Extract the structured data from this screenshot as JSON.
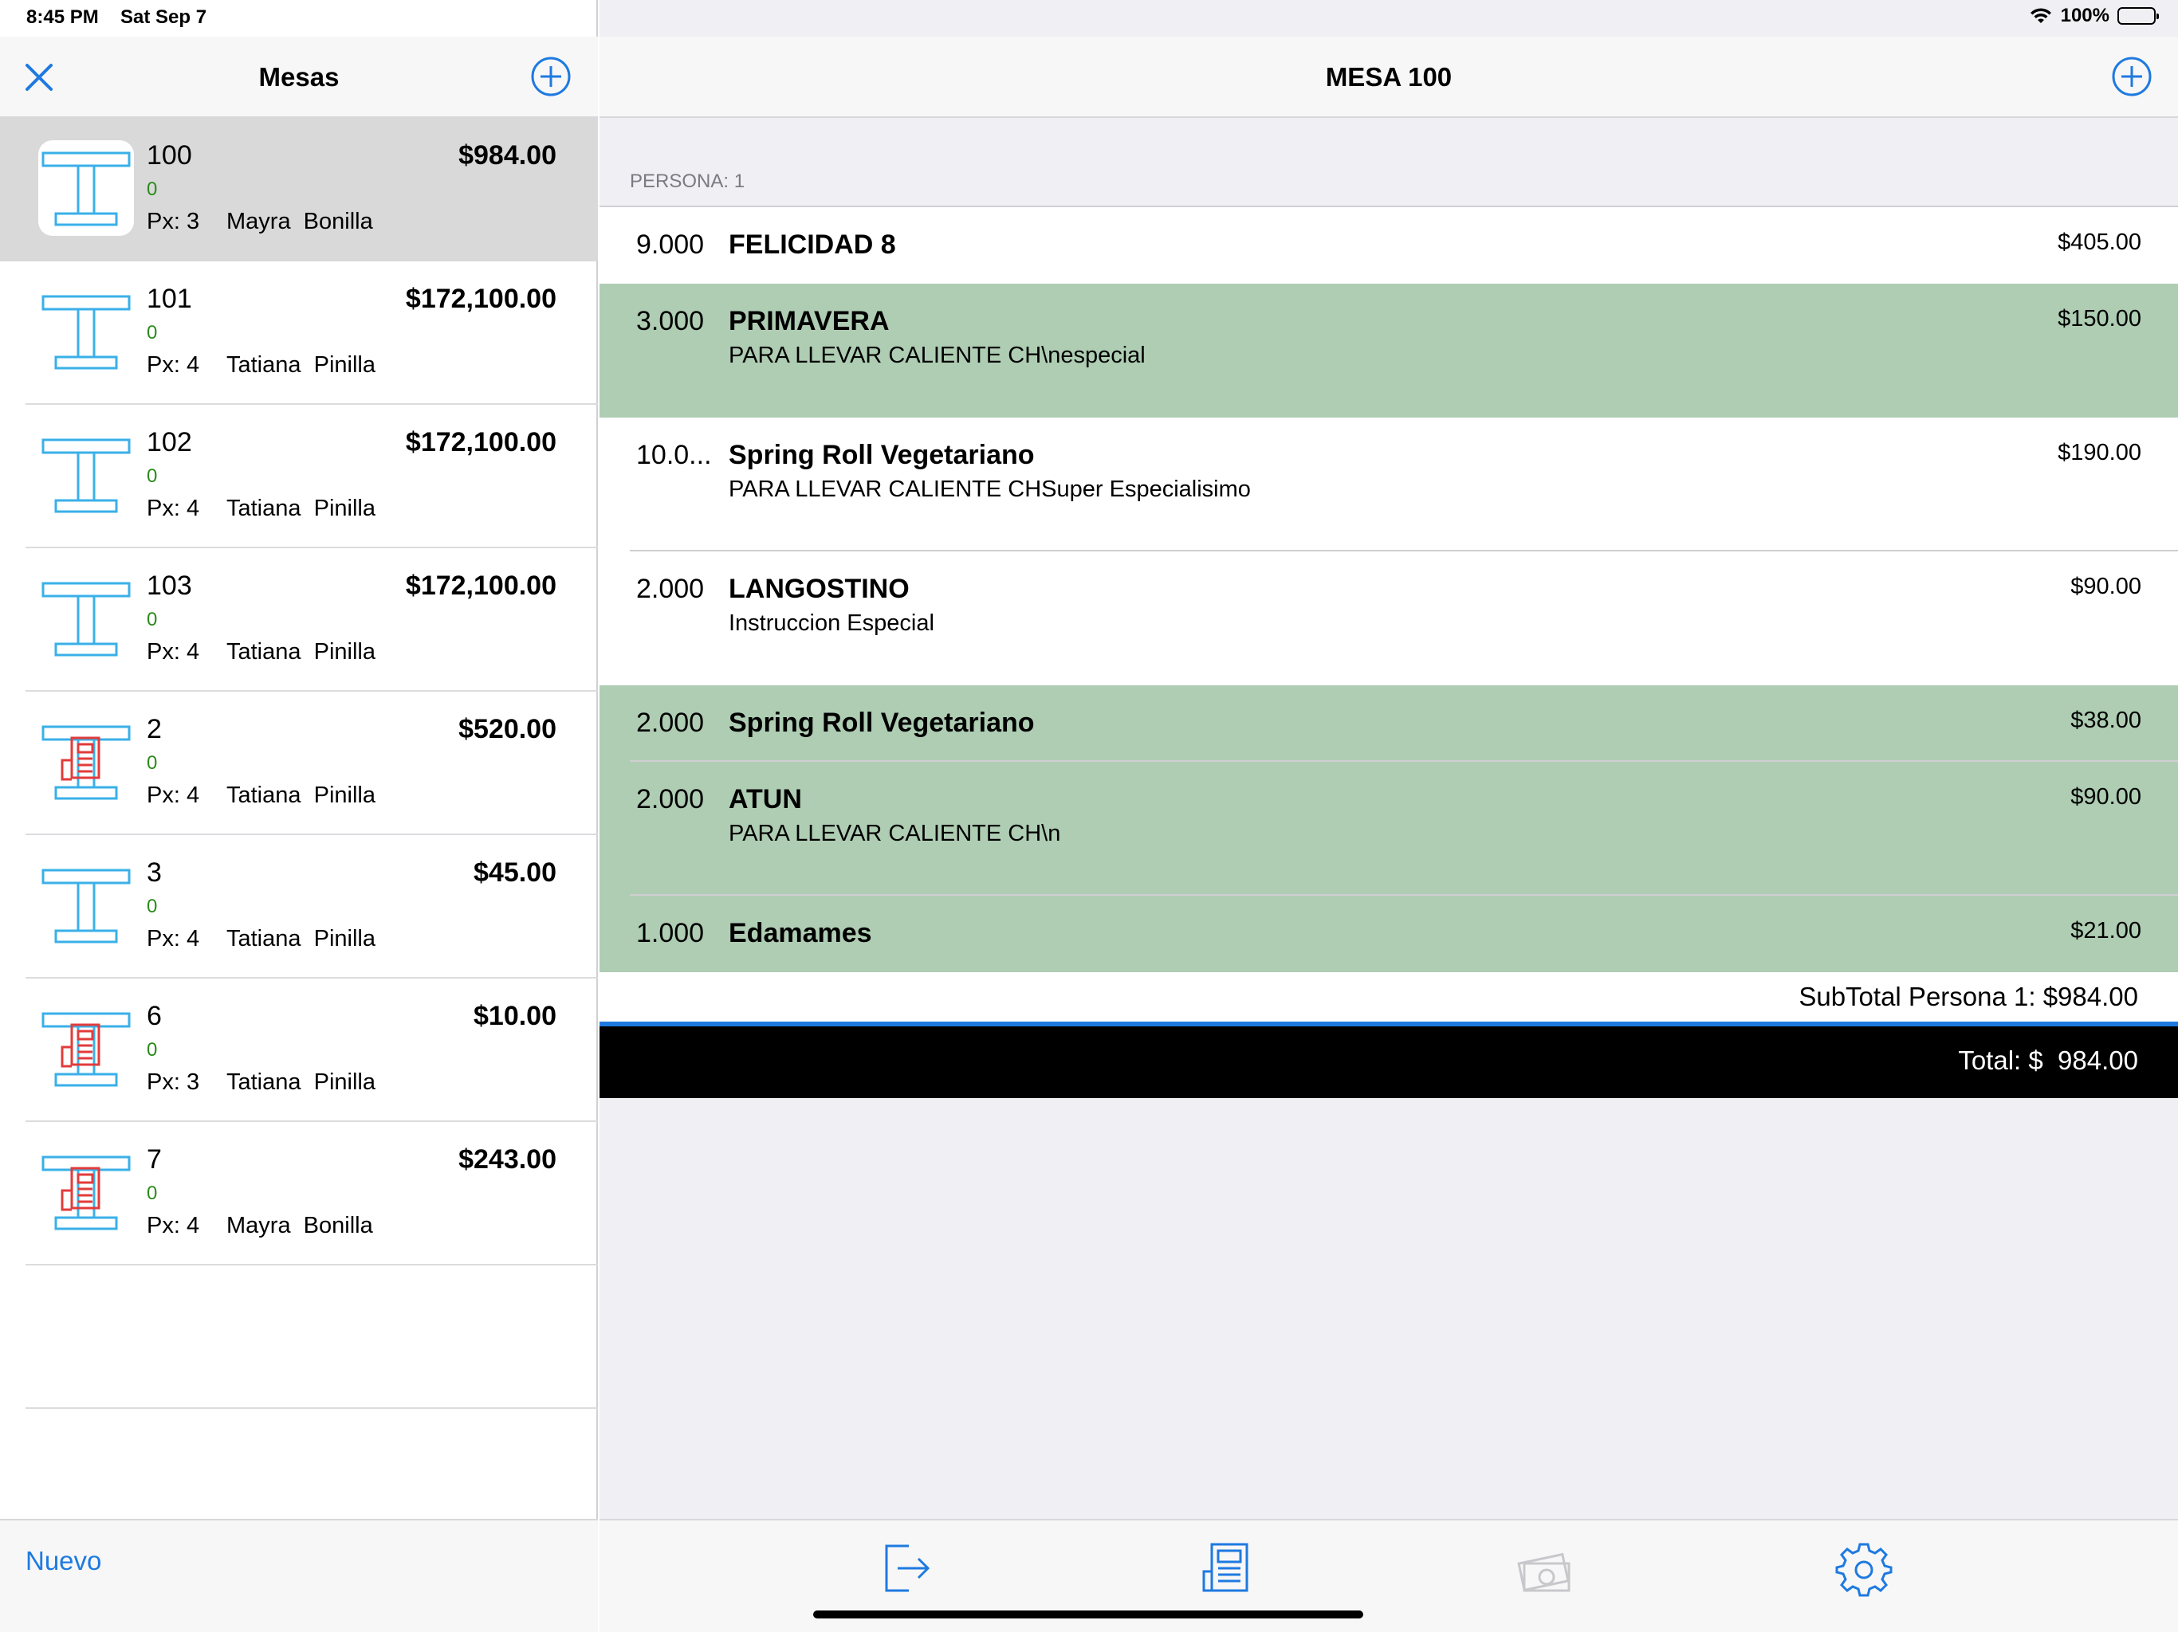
{
  "status_bar": {
    "time": "8:45 PM",
    "date": "Sat Sep 7",
    "battery": "100%"
  },
  "left_panel": {
    "title": "Mesas",
    "tables": [
      {
        "number": "100",
        "zero": "0",
        "px": "Px: 3",
        "waiter": "Mayra  Bonilla",
        "amount": "$984.00",
        "icon": "table-icon",
        "selected": true
      },
      {
        "number": "101",
        "zero": "0",
        "px": "Px: 4",
        "waiter": "Tatiana  Pinilla",
        "amount": "$172,100.00",
        "icon": "table-icon",
        "selected": false
      },
      {
        "number": "102",
        "zero": "0",
        "px": "Px: 4",
        "waiter": "Tatiana  Pinilla",
        "amount": "$172,100.00",
        "icon": "table-icon",
        "selected": false
      },
      {
        "number": "103",
        "zero": "0",
        "px": "Px: 4",
        "waiter": "Tatiana  Pinilla",
        "amount": "$172,100.00",
        "icon": "table-icon",
        "selected": false
      },
      {
        "number": "2",
        "zero": "0",
        "px": "Px: 4",
        "waiter": "Tatiana  Pinilla",
        "amount": "$520.00",
        "icon": "table-with-receipt-icon",
        "selected": false
      },
      {
        "number": "3",
        "zero": "0",
        "px": "Px: 4",
        "waiter": "Tatiana  Pinilla",
        "amount": "$45.00",
        "icon": "table-icon",
        "selected": false
      },
      {
        "number": "6",
        "zero": "0",
        "px": "Px: 3",
        "waiter": "Tatiana  Pinilla",
        "amount": "$10.00",
        "icon": "table-with-receipt-icon",
        "selected": false
      },
      {
        "number": "7",
        "zero": "0",
        "px": "Px: 4",
        "waiter": "Mayra  Bonilla",
        "amount": "$243.00",
        "icon": "table-with-receipt-icon",
        "selected": false
      }
    ],
    "new_button": "Nuevo"
  },
  "right_panel": {
    "title": "MESA 100",
    "persona_header": "PERSONA: 1",
    "items": [
      {
        "qty": "9.000",
        "name": "FELICIDAD 8",
        "note": "",
        "price": "$405.00",
        "highlighted": false,
        "tall": false
      },
      {
        "qty": "3.000",
        "name": "PRIMAVERA",
        "note": "PARA LLEVAR CALIENTE CH\\nespecial",
        "price": "$150.00",
        "highlighted": true,
        "tall": true
      },
      {
        "qty": "10.0...",
        "name": "Spring Roll Vegetariano",
        "note": "PARA LLEVAR CALIENTE CHSuper Especialisimo",
        "price": "$190.00",
        "highlighted": false,
        "tall": true
      },
      {
        "qty": "2.000",
        "name": "LANGOSTINO",
        "note": "Instruccion Especial",
        "price": "$90.00",
        "highlighted": false,
        "tall": true
      },
      {
        "qty": "2.000",
        "name": "Spring Roll Vegetariano",
        "note": "",
        "price": "$38.00",
        "highlighted": true,
        "tall": false
      },
      {
        "qty": "2.000",
        "name": "ATUN",
        "note": "PARA LLEVAR CALIENTE CH\\n",
        "price": "$90.00",
        "highlighted": true,
        "tall": true
      },
      {
        "qty": "1.000",
        "name": "Edamames",
        "note": "",
        "price": "$21.00",
        "highlighted": true,
        "tall": false
      }
    ],
    "subtotal": "SubTotal Persona 1: $984.00",
    "total": "Total: $  984.00",
    "toolbar": [
      {
        "name": "exit-icon",
        "enabled": true
      },
      {
        "name": "receipt-icon",
        "enabled": true
      },
      {
        "name": "money-icon",
        "enabled": false
      },
      {
        "name": "gear-icon",
        "enabled": true
      }
    ]
  },
  "colors": {
    "accent": "#1e7ae0",
    "highlight_row": "#aecdb3",
    "table_icon": "#3ab0e8",
    "receipt_icon": "#e23b3b",
    "green_text": "#2a8a1a"
  }
}
